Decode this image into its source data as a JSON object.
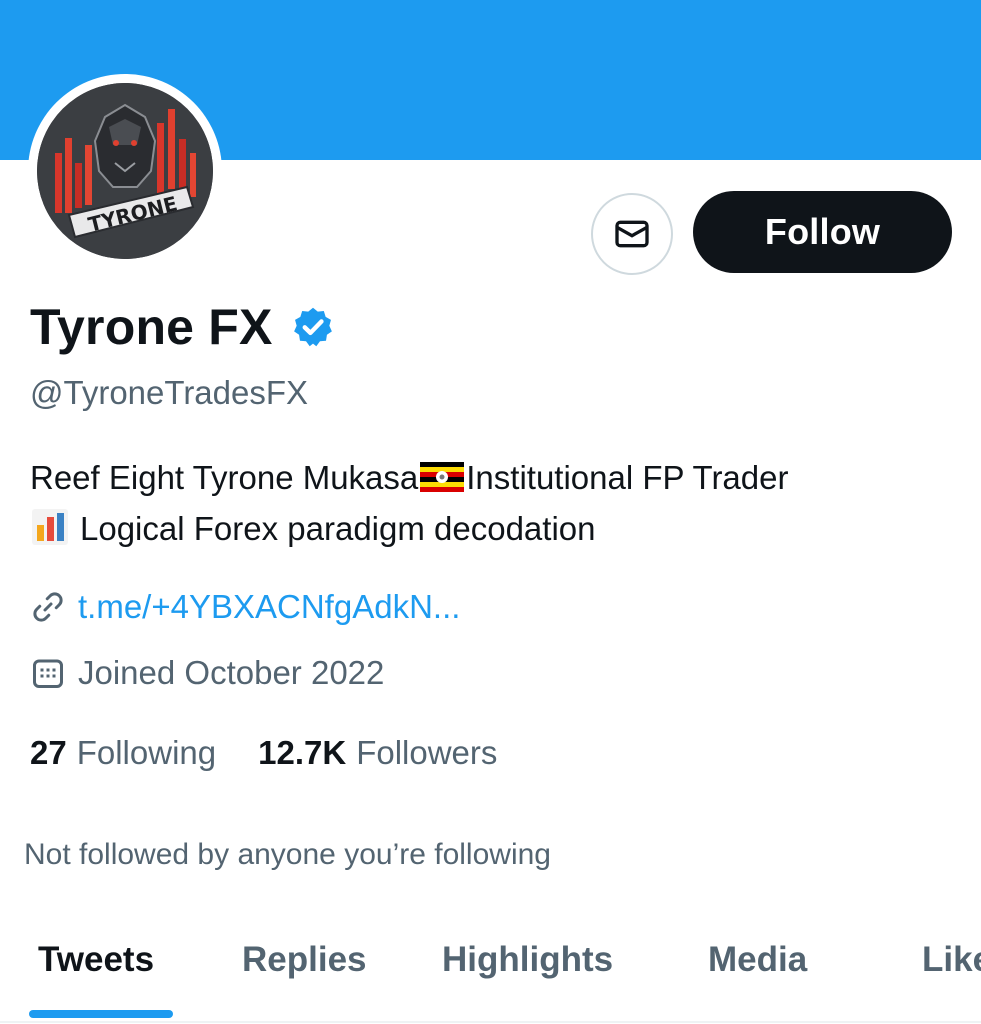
{
  "profile": {
    "display_name": "Tyrone FX",
    "handle": "@TyroneTradesFX",
    "bio_line1_a": "Reef Eight Tyrone Mukasa",
    "bio_line1_b": "Institutional FP Trader",
    "bio_line2": "Logical Forex paradigm decodation",
    "avatar_text": "TYRONE",
    "link": "t.me/+4YBXACNfgAdkN...",
    "joined": "Joined October 2022"
  },
  "actions": {
    "follow_label": "Follow"
  },
  "stats": {
    "following_count": "27",
    "following_label": "Following",
    "followers_count": "12.7K",
    "followers_label": "Followers"
  },
  "mutuals_text": "Not followed by anyone you’re following",
  "tabs": [
    {
      "label": "Tweets",
      "active": true
    },
    {
      "label": "Replies",
      "active": false
    },
    {
      "label": "Highlights",
      "active": false
    },
    {
      "label": "Media",
      "active": false
    },
    {
      "label": "Likes",
      "active": false
    }
  ],
  "icons": {
    "message": "envelope-icon",
    "verified": "verified-badge-icon",
    "link": "link-icon",
    "calendar": "calendar-icon",
    "flag": "uganda-flag-emoji",
    "chart": "bar-chart-emoji"
  },
  "colors": {
    "accent": "#1d9bf0",
    "text": "#0f1419",
    "muted": "#536471",
    "button_bg": "#0f1419"
  }
}
